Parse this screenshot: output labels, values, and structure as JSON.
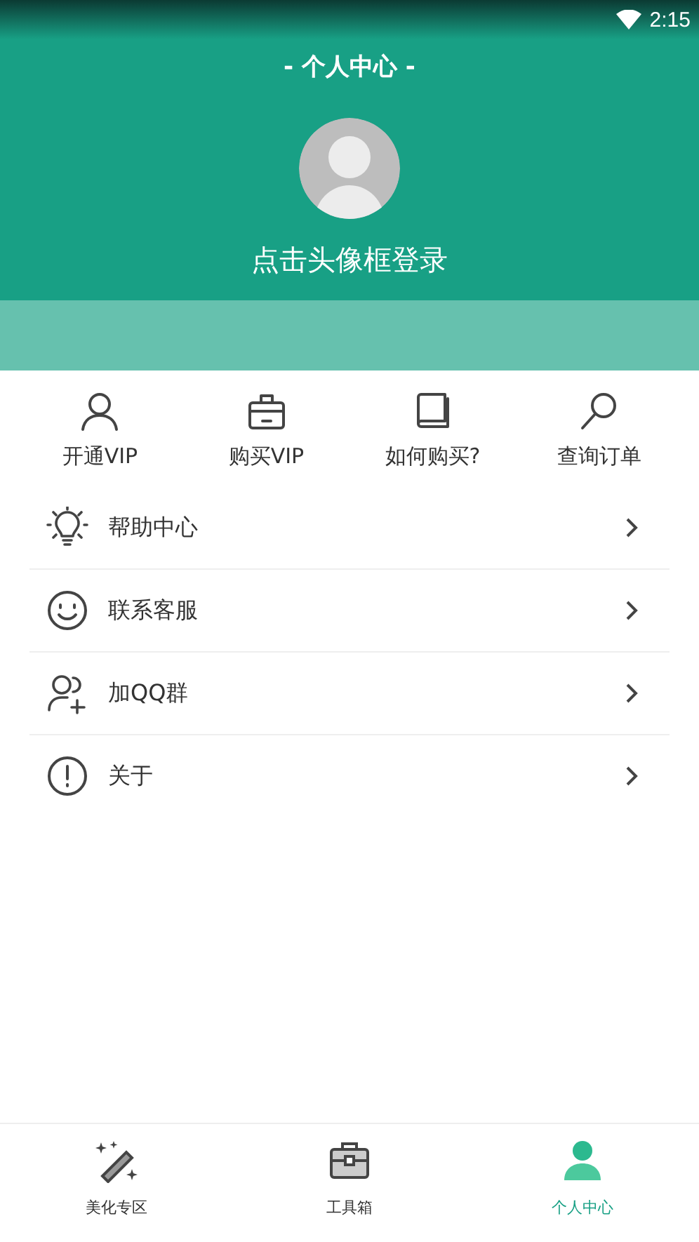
{
  "status_bar": {
    "time": "2:15"
  },
  "header": {
    "title": "- 个人中心 -",
    "login_prompt": "点击头像框登录"
  },
  "quick_actions": [
    {
      "kind": "person",
      "label": "开通VIP"
    },
    {
      "kind": "bag",
      "label": "购买VIP"
    },
    {
      "kind": "book",
      "label": "如何购买?"
    },
    {
      "kind": "search",
      "label": "查询订单"
    }
  ],
  "menu": [
    {
      "kind": "bulb",
      "label": "帮助中心"
    },
    {
      "kind": "smile",
      "label": "联系客服"
    },
    {
      "kind": "group",
      "label": "加QQ群"
    },
    {
      "kind": "info",
      "label": "关于"
    }
  ],
  "bottom_nav": [
    {
      "kind": "wand",
      "label": "美化专区",
      "selected": false
    },
    {
      "kind": "toolbox",
      "label": "工具箱",
      "selected": false
    },
    {
      "kind": "user",
      "label": "个人中心",
      "selected": true
    }
  ]
}
